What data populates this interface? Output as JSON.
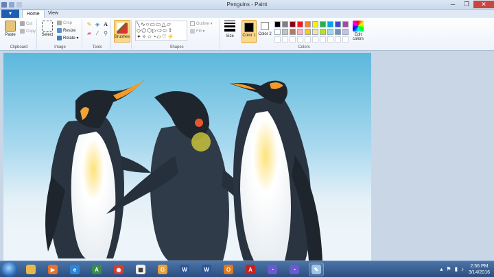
{
  "window": {
    "title": "Penguins - Paint",
    "minimize": "─",
    "maximize": "❐",
    "close": "✕"
  },
  "tabs": {
    "file": "▾",
    "home": "Home",
    "view": "View"
  },
  "clipboard": {
    "paste": "Paste",
    "cut": "Cut",
    "copy": "Copy",
    "label": "Clipboard"
  },
  "image": {
    "select": "Select",
    "crop": "Crop",
    "resize": "Resize",
    "rotate": "Rotate ▾",
    "label": "Image"
  },
  "tools": {
    "label": "Tools"
  },
  "brushes": {
    "label": "Brushes"
  },
  "shapes": {
    "outline": "Outline ▾",
    "fill": "Fill ▾",
    "label": "Shapes"
  },
  "size": {
    "label": "Size"
  },
  "colors": {
    "color1": "Color 1",
    "color2": "Color 2",
    "edit": "Edit colors",
    "label": "Colors",
    "palette_row1": [
      "#000000",
      "#7f7f7f",
      "#880015",
      "#ed1c24",
      "#ff7f27",
      "#fff200",
      "#22b14c",
      "#00a2e8",
      "#3f48cc",
      "#a349a4"
    ],
    "palette_row2": [
      "#ffffff",
      "#c3c3c3",
      "#b97a57",
      "#ffaec9",
      "#ffc90e",
      "#efe4b0",
      "#b5e61d",
      "#99d9ea",
      "#7092be",
      "#c8bfe7"
    ]
  },
  "taskbar": {
    "icons": [
      "folder-icon",
      "media-player-icon",
      "internet-explorer-icon",
      "android-studio-icon",
      "chrome-icon",
      "app-grid-icon",
      "gmx-icon",
      "word-icon",
      "word-icon-2",
      "outlook-icon",
      "acrobat-icon",
      "speed-icon",
      "speed-icon-2",
      "paint-icon"
    ],
    "time": "2:56 PM",
    "date": "3/14/2016"
  }
}
